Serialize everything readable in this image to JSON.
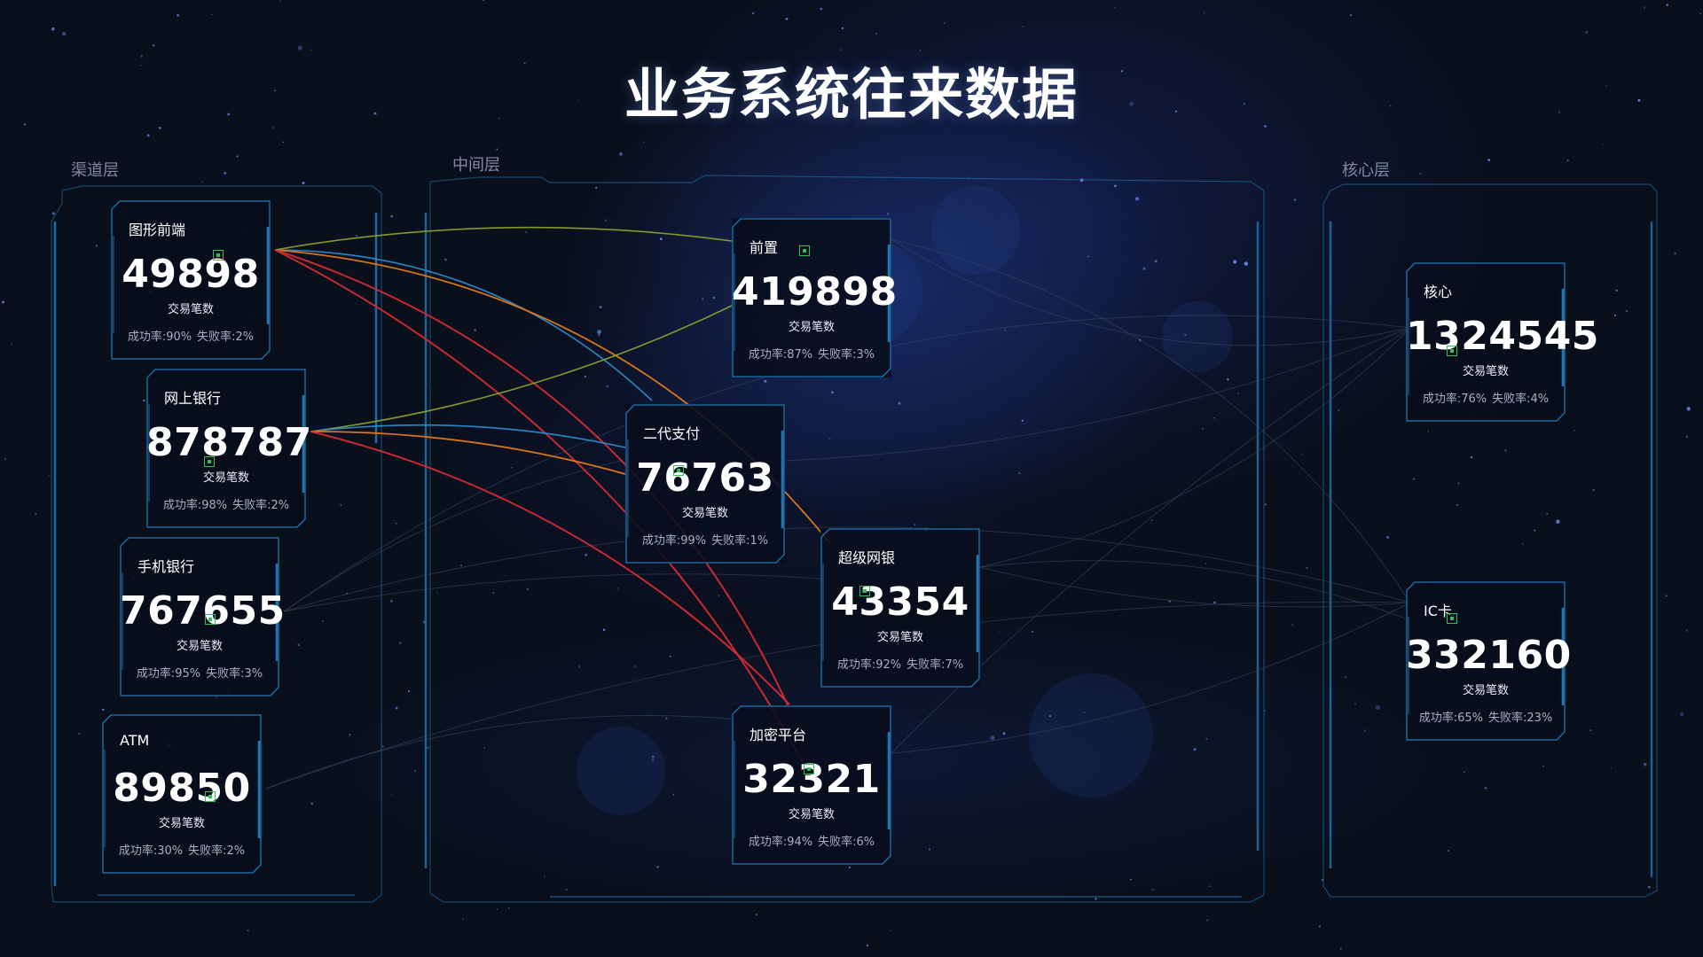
{
  "title": "业务系统往来数据",
  "layers": {
    "channel": "渠道层",
    "middle": "中间层",
    "core": "核心层"
  },
  "caption": "交易笔数",
  "success_prefix": "成功率:",
  "fail_prefix": "失败率:",
  "nodes": {
    "graphic_frontend": {
      "name": "图形前端",
      "value": "49898",
      "success": "90%",
      "fail": "2%"
    },
    "online_banking": {
      "name": "网上银行",
      "value": "878787",
      "success": "98%",
      "fail": "2%"
    },
    "mobile_banking": {
      "name": "手机银行",
      "value": "767655",
      "success": "95%",
      "fail": "3%"
    },
    "atm": {
      "name": "ATM",
      "value": "89850",
      "success": "30%",
      "fail": "2%"
    },
    "frontend": {
      "name": "前置",
      "value": "419898",
      "success": "87%",
      "fail": "3%"
    },
    "cnaps2": {
      "name": "二代支付",
      "value": "76763",
      "success": "99%",
      "fail": "1%"
    },
    "super_ebank": {
      "name": "超级网银",
      "value": "43354",
      "success": "92%",
      "fail": "7%"
    },
    "encryption": {
      "name": "加密平台",
      "value": "32321",
      "success": "94%",
      "fail": "6%"
    },
    "core": {
      "name": "核心",
      "value": "1324545",
      "success": "76%",
      "fail": "4%"
    },
    "ic_card": {
      "name": "IC卡",
      "value": "332160",
      "success": "65%",
      "fail": "23%"
    }
  },
  "link_colors": {
    "red": "#d22b35",
    "orange": "#e07a1c",
    "blue": "#2a8fd0",
    "olive": "#8aa030",
    "faint": "#3a4a66",
    "frame": "#1f78b4",
    "marker": "#2fc05a"
  }
}
